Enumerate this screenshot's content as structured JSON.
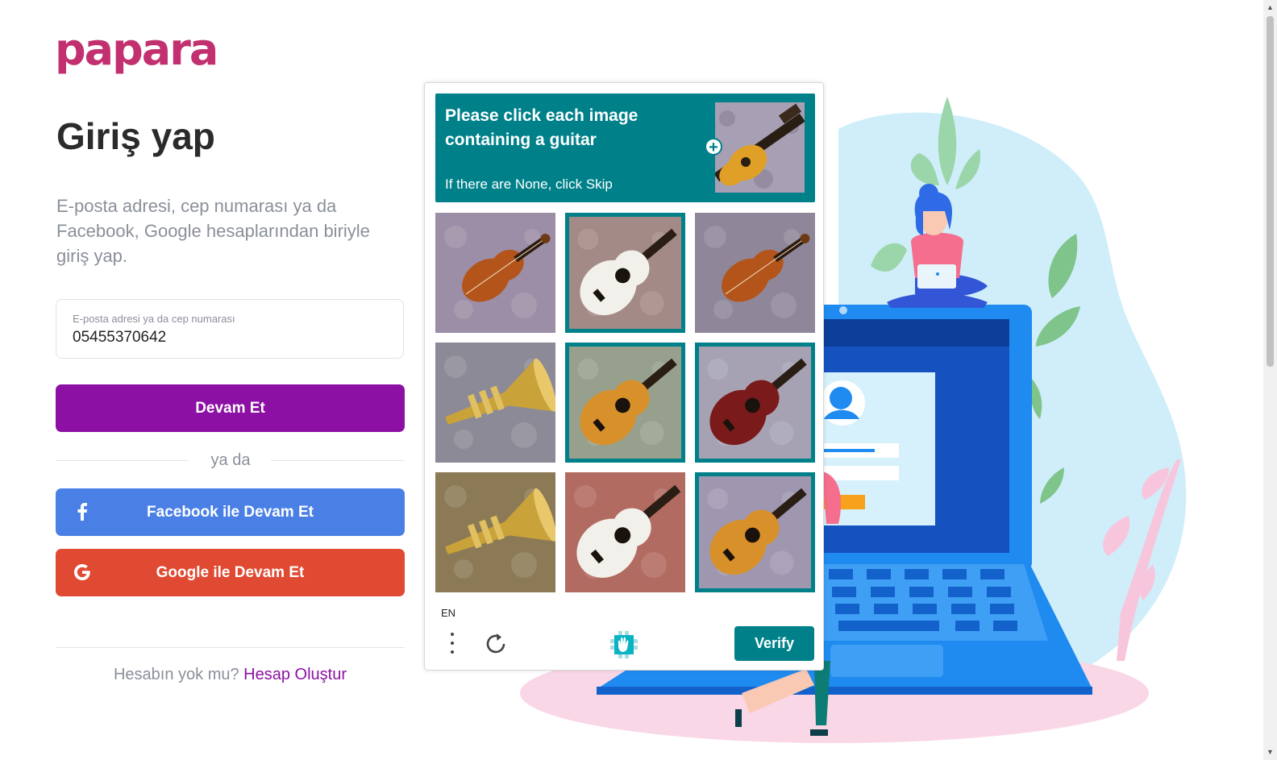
{
  "brand": {
    "logo_text": "papara"
  },
  "login": {
    "title": "Giriş yap",
    "subtitle": "E-posta adresi, cep numarası ya da Facebook, Google hesaplarından biriyle giriş yap.",
    "field_label": "E-posta adresi ya da cep numarası",
    "field_value": "05455370642",
    "continue_label": "Devam Et",
    "or_label": "ya da",
    "facebook_label": "Facebook ile Devam Et",
    "google_label": "Google ile Devam Et",
    "signup_prompt": "Hesabın yok mu?",
    "signup_link": "Hesap Oluştur"
  },
  "captcha": {
    "prompt": "Please click each image containing a guitar",
    "hint": "If there are None, click Skip",
    "language": "EN",
    "verify_label": "Verify",
    "tiles": [
      {
        "content": "violin",
        "selected": false
      },
      {
        "content": "guitar",
        "selected": true
      },
      {
        "content": "violin",
        "selected": false
      },
      {
        "content": "trumpet",
        "selected": false
      },
      {
        "content": "guitar",
        "selected": true
      },
      {
        "content": "guitar",
        "selected": true
      },
      {
        "content": "trumpet",
        "selected": false
      },
      {
        "content": "guitar",
        "selected": false
      },
      {
        "content": "guitar",
        "selected": true
      }
    ]
  },
  "colors": {
    "brand_purple": "#8b10a3",
    "facebook_blue": "#4a80e6",
    "google_red": "#e04a33",
    "captcha_teal": "#00818a",
    "logo_pink": "#c2306f"
  },
  "icons": [
    "facebook-icon",
    "google-icon",
    "more-options-icon",
    "refresh-icon",
    "hcaptcha-logo-icon",
    "plus-icon"
  ]
}
